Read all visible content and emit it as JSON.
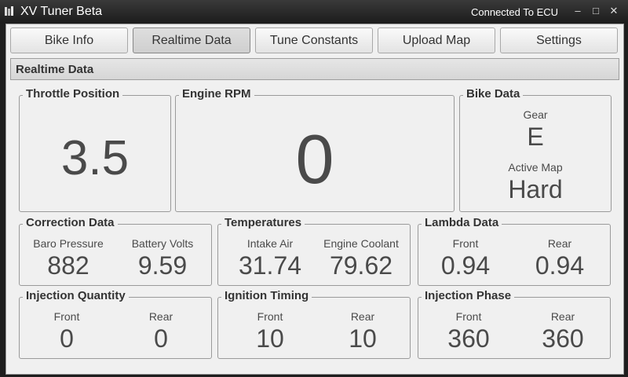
{
  "window": {
    "title": "XV Tuner Beta",
    "status": "Connected To ECU"
  },
  "tabs": [
    {
      "label": "Bike Info"
    },
    {
      "label": "Realtime Data"
    },
    {
      "label": "Tune Constants"
    },
    {
      "label": "Upload Map"
    },
    {
      "label": "Settings"
    }
  ],
  "section": {
    "title": "Realtime Data"
  },
  "throttle": {
    "title": "Throttle Position",
    "value": "3.5"
  },
  "rpm": {
    "title": "Engine RPM",
    "value": "0"
  },
  "bike": {
    "title": "Bike Data",
    "gear_label": "Gear",
    "gear_value": "E",
    "map_label": "Active Map",
    "map_value": "Hard"
  },
  "correction": {
    "title": "Correction Data",
    "a_label": "Baro Pressure",
    "a_value": "882",
    "b_label": "Battery Volts",
    "b_value": "9.59"
  },
  "temps": {
    "title": "Temperatures",
    "a_label": "Intake Air",
    "a_value": "31.74",
    "b_label": "Engine Coolant",
    "b_value": "79.62"
  },
  "lambda": {
    "title": "Lambda Data",
    "a_label": "Front",
    "a_value": "0.94",
    "b_label": "Rear",
    "b_value": "0.94"
  },
  "injq": {
    "title": "Injection Quantity",
    "a_label": "Front",
    "a_value": "0",
    "b_label": "Rear",
    "b_value": "0"
  },
  "ign": {
    "title": "Ignition Timing",
    "a_label": "Front",
    "a_value": "10",
    "b_label": "Rear",
    "b_value": "10"
  },
  "injp": {
    "title": "Injection Phase",
    "a_label": "Front",
    "a_value": "360",
    "b_label": "Rear",
    "b_value": "360"
  }
}
